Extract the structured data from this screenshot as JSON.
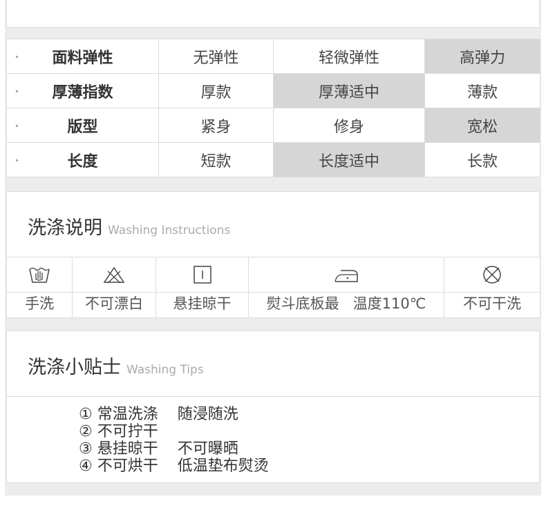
{
  "attributes": [
    {
      "name": "面料弹性",
      "options": [
        "无弹性",
        "轻微弹性",
        "高弹力"
      ],
      "selected": 2
    },
    {
      "name": "厚薄指数",
      "options": [
        "厚款",
        "厚薄适中",
        "薄款"
      ],
      "selected": 1
    },
    {
      "name": "版型",
      "options": [
        "紧身",
        "修身",
        "宽松"
      ],
      "selected": 2
    },
    {
      "name": "长度",
      "options": [
        "短款",
        "长度适中",
        "长款"
      ],
      "selected": 1
    }
  ],
  "washing": {
    "title": "洗涤说明",
    "title_en": "Washing Instructions",
    "items": [
      {
        "icon": "hand-wash-icon",
        "label": "手洗"
      },
      {
        "icon": "no-bleach-icon",
        "label": "不可漂白"
      },
      {
        "icon": "hang-dry-icon",
        "label": "悬挂晾干"
      },
      {
        "icon": "iron-low-icon",
        "label": "熨斗底板最   温度110℃"
      },
      {
        "icon": "no-dry-clean-icon",
        "label": "不可干洗"
      }
    ]
  },
  "tips": {
    "title": "洗涤小贴士",
    "title_en": "Washing Tips",
    "lines": [
      "① 常温洗涤    随浸随洗",
      "② 不可拧干",
      "③ 悬挂晾干    不可曝晒",
      "④ 不可烘干    低温垫布熨烫"
    ]
  },
  "colors": {
    "selected_cell": "#d6d6d6",
    "border": "#dcdcdc",
    "gutter": "#ececec"
  }
}
